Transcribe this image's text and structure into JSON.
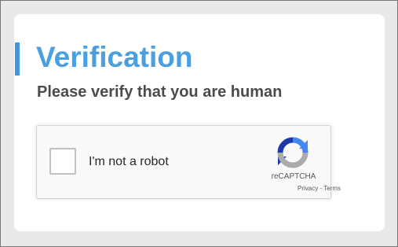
{
  "page": {
    "title": "Verification",
    "subtitle": "Please verify that you are human"
  },
  "recaptcha": {
    "checkbox_label": "I'm not a robot",
    "brand": "reCAPTCHA",
    "privacy_link": "Privacy",
    "separator": "-",
    "terms_link": "Terms",
    "logo_icon": "recaptcha-logo-icon",
    "checked": false
  },
  "colors": {
    "accent": "#3f97df",
    "title": "#4a9fe0",
    "subtitle": "#4c4c4c",
    "logo_dark_blue": "#1c3aa9",
    "logo_blue": "#4285f4",
    "logo_gray": "#ababab"
  }
}
